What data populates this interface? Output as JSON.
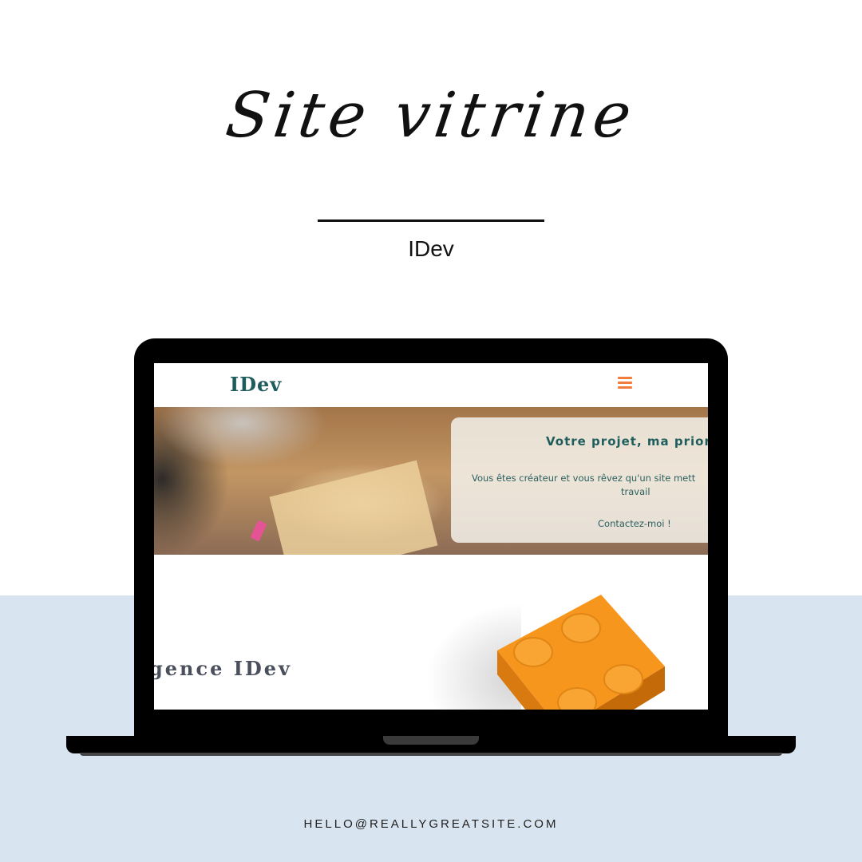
{
  "title": "Site vitrine",
  "subtitle": "IDev",
  "email": "HELLO@REALLYGREATSITE.COM",
  "colors": {
    "background_top": "#ffffff",
    "background_bottom": "#d8e4ef",
    "brand_teal": "#1f5d5c",
    "accent_orange": "#f07c3e"
  },
  "website": {
    "logo": "IDev",
    "menu_icon": "hamburger-menu-icon",
    "hero": {
      "heading": "Votre projet, ma prior",
      "text_line1": "Vous êtes créateur et vous rêvez qu'un site mett",
      "text_line2": "travail",
      "cta": "Contactez-moi !"
    },
    "section2_title": "gence IDev"
  }
}
